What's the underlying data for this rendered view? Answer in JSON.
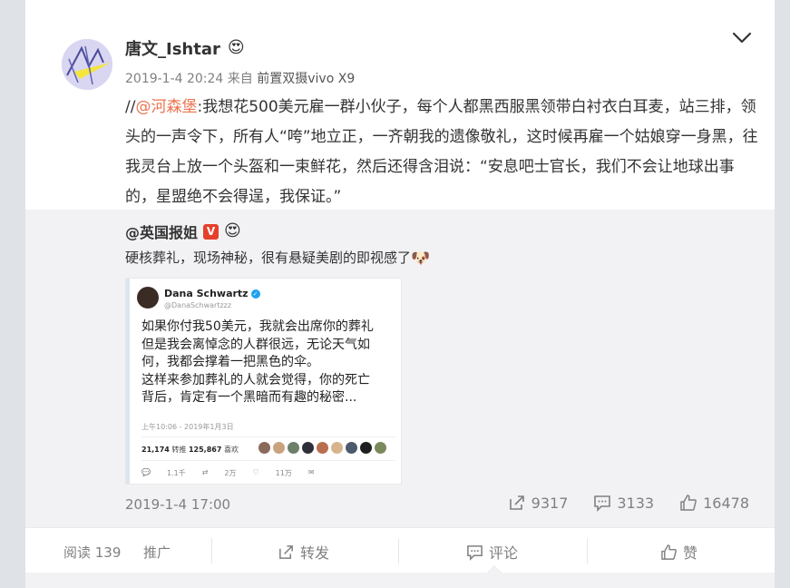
{
  "post": {
    "username": "唐文_Ishtar",
    "user_badge_icon": "heart-eyes-emoji-icon",
    "timestamp": "2019-1-4 20:24",
    "source_prefix": "来自",
    "source": "前置双摄vivo X9",
    "text_prefix": "//",
    "mention": "@河森堡",
    "text": ":我想花500美元雇一群小伙子，每个人都黑西服黑领带白衬衣白耳麦，站三排，领头的一声令下，所有人“咵”地立正，一齐朝我的遗像敬礼，这时候再雇一个姑娘穿一身黑，往我灵台上放一个头盔和一束鲜花，然后还得含泪说：“安息吧士官长，我们不会让地球出事的，星盟绝不会得逞，我保证。”"
  },
  "quoted": {
    "username": "@英国报姐",
    "verified_badge": "V",
    "text": "硬核葬礼，现场神秘，很有悬疑美剧的即视感了",
    "text_emoji_icon": "doge-icon",
    "date": "2019-1-4 17:00",
    "stats": {
      "forward": "9317",
      "comment": "3133",
      "like": "16478"
    },
    "image": {
      "name": "Dana Schwartz",
      "handle": "@DanaSchwartzzz",
      "body": "如果你付我50美元，我就会出席你的葬礼\n但是我会离悼念的人群很远，无论天气如\n何，我都会撑着一把黑色的伞。\n这样来参加葬礼的人就会觉得，你的死亡\n背后，肯定有一个黑暗而有趣的秘密...",
      "time": "上午10:06 - 2019年1月3日",
      "retweets": "21,174",
      "retweets_label": "转推",
      "likes": "125,867",
      "likes_label": "喜欢",
      "reply_count": "1.1千",
      "retweet_count": "2万",
      "like_count": "11万"
    }
  },
  "actions": {
    "read": "阅读 139",
    "promote": "推广",
    "forward": "转发",
    "comment": "评论",
    "like": "赞"
  },
  "colors": {
    "mention": "#eb7350",
    "verified": "#e5402b",
    "quote_bg": "#f2f2f5",
    "page_bg": "#dfe3e8"
  }
}
